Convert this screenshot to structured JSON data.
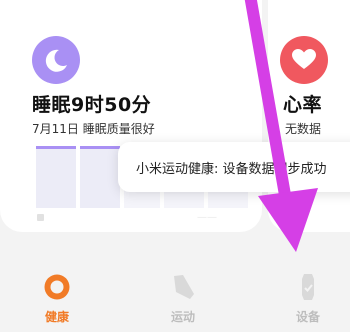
{
  "sleep_card": {
    "value": "睡眠9时50分",
    "subtitle": "7月11日 睡眠质量很好",
    "icon": "moon-icon",
    "accent": "#a990f4"
  },
  "heart_card": {
    "value": "心率",
    "subtitle": "无数据",
    "icon": "heart-icon",
    "accent": "#f0585f"
  },
  "toast": {
    "text": "小米运动健康: 设备数据同步成功"
  },
  "bottom_nav": {
    "items": [
      {
        "label": "健康",
        "icon": "health-icon",
        "active": true
      },
      {
        "label": "运动",
        "icon": "sport-shoe-icon",
        "active": false
      },
      {
        "label": "设备",
        "icon": "watch-icon",
        "active": false
      }
    ],
    "active_color": "#f17b27"
  },
  "overlay": {
    "arrow_color": "#d53fe6",
    "icon": "arrow-down-icon"
  }
}
